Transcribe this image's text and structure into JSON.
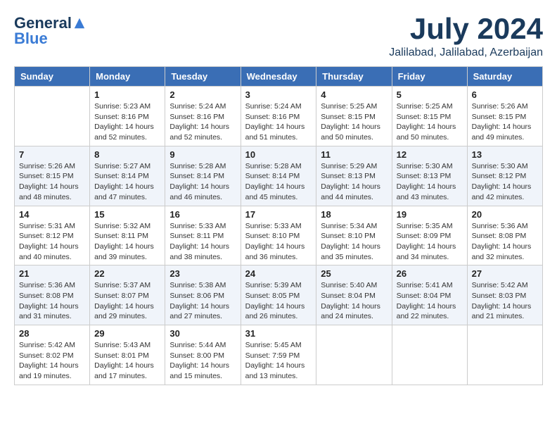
{
  "header": {
    "logo_general": "General",
    "logo_blue": "Blue",
    "month": "July 2024",
    "location": "Jalilabad, Jalilabad, Azerbaijan"
  },
  "days_of_week": [
    "Sunday",
    "Monday",
    "Tuesday",
    "Wednesday",
    "Thursday",
    "Friday",
    "Saturday"
  ],
  "weeks": [
    [
      {
        "day": "",
        "info": ""
      },
      {
        "day": "1",
        "info": "Sunrise: 5:23 AM\nSunset: 8:16 PM\nDaylight: 14 hours\nand 52 minutes."
      },
      {
        "day": "2",
        "info": "Sunrise: 5:24 AM\nSunset: 8:16 PM\nDaylight: 14 hours\nand 52 minutes."
      },
      {
        "day": "3",
        "info": "Sunrise: 5:24 AM\nSunset: 8:16 PM\nDaylight: 14 hours\nand 51 minutes."
      },
      {
        "day": "4",
        "info": "Sunrise: 5:25 AM\nSunset: 8:15 PM\nDaylight: 14 hours\nand 50 minutes."
      },
      {
        "day": "5",
        "info": "Sunrise: 5:25 AM\nSunset: 8:15 PM\nDaylight: 14 hours\nand 50 minutes."
      },
      {
        "day": "6",
        "info": "Sunrise: 5:26 AM\nSunset: 8:15 PM\nDaylight: 14 hours\nand 49 minutes."
      }
    ],
    [
      {
        "day": "7",
        "info": "Sunrise: 5:26 AM\nSunset: 8:15 PM\nDaylight: 14 hours\nand 48 minutes."
      },
      {
        "day": "8",
        "info": "Sunrise: 5:27 AM\nSunset: 8:14 PM\nDaylight: 14 hours\nand 47 minutes."
      },
      {
        "day": "9",
        "info": "Sunrise: 5:28 AM\nSunset: 8:14 PM\nDaylight: 14 hours\nand 46 minutes."
      },
      {
        "day": "10",
        "info": "Sunrise: 5:28 AM\nSunset: 8:14 PM\nDaylight: 14 hours\nand 45 minutes."
      },
      {
        "day": "11",
        "info": "Sunrise: 5:29 AM\nSunset: 8:13 PM\nDaylight: 14 hours\nand 44 minutes."
      },
      {
        "day": "12",
        "info": "Sunrise: 5:30 AM\nSunset: 8:13 PM\nDaylight: 14 hours\nand 43 minutes."
      },
      {
        "day": "13",
        "info": "Sunrise: 5:30 AM\nSunset: 8:12 PM\nDaylight: 14 hours\nand 42 minutes."
      }
    ],
    [
      {
        "day": "14",
        "info": "Sunrise: 5:31 AM\nSunset: 8:12 PM\nDaylight: 14 hours\nand 40 minutes."
      },
      {
        "day": "15",
        "info": "Sunrise: 5:32 AM\nSunset: 8:11 PM\nDaylight: 14 hours\nand 39 minutes."
      },
      {
        "day": "16",
        "info": "Sunrise: 5:33 AM\nSunset: 8:11 PM\nDaylight: 14 hours\nand 38 minutes."
      },
      {
        "day": "17",
        "info": "Sunrise: 5:33 AM\nSunset: 8:10 PM\nDaylight: 14 hours\nand 36 minutes."
      },
      {
        "day": "18",
        "info": "Sunrise: 5:34 AM\nSunset: 8:10 PM\nDaylight: 14 hours\nand 35 minutes."
      },
      {
        "day": "19",
        "info": "Sunrise: 5:35 AM\nSunset: 8:09 PM\nDaylight: 14 hours\nand 34 minutes."
      },
      {
        "day": "20",
        "info": "Sunrise: 5:36 AM\nSunset: 8:08 PM\nDaylight: 14 hours\nand 32 minutes."
      }
    ],
    [
      {
        "day": "21",
        "info": "Sunrise: 5:36 AM\nSunset: 8:08 PM\nDaylight: 14 hours\nand 31 minutes."
      },
      {
        "day": "22",
        "info": "Sunrise: 5:37 AM\nSunset: 8:07 PM\nDaylight: 14 hours\nand 29 minutes."
      },
      {
        "day": "23",
        "info": "Sunrise: 5:38 AM\nSunset: 8:06 PM\nDaylight: 14 hours\nand 27 minutes."
      },
      {
        "day": "24",
        "info": "Sunrise: 5:39 AM\nSunset: 8:05 PM\nDaylight: 14 hours\nand 26 minutes."
      },
      {
        "day": "25",
        "info": "Sunrise: 5:40 AM\nSunset: 8:04 PM\nDaylight: 14 hours\nand 24 minutes."
      },
      {
        "day": "26",
        "info": "Sunrise: 5:41 AM\nSunset: 8:04 PM\nDaylight: 14 hours\nand 22 minutes."
      },
      {
        "day": "27",
        "info": "Sunrise: 5:42 AM\nSunset: 8:03 PM\nDaylight: 14 hours\nand 21 minutes."
      }
    ],
    [
      {
        "day": "28",
        "info": "Sunrise: 5:42 AM\nSunset: 8:02 PM\nDaylight: 14 hours\nand 19 minutes."
      },
      {
        "day": "29",
        "info": "Sunrise: 5:43 AM\nSunset: 8:01 PM\nDaylight: 14 hours\nand 17 minutes."
      },
      {
        "day": "30",
        "info": "Sunrise: 5:44 AM\nSunset: 8:00 PM\nDaylight: 14 hours\nand 15 minutes."
      },
      {
        "day": "31",
        "info": "Sunrise: 5:45 AM\nSunset: 7:59 PM\nDaylight: 14 hours\nand 13 minutes."
      },
      {
        "day": "",
        "info": ""
      },
      {
        "day": "",
        "info": ""
      },
      {
        "day": "",
        "info": ""
      }
    ]
  ]
}
